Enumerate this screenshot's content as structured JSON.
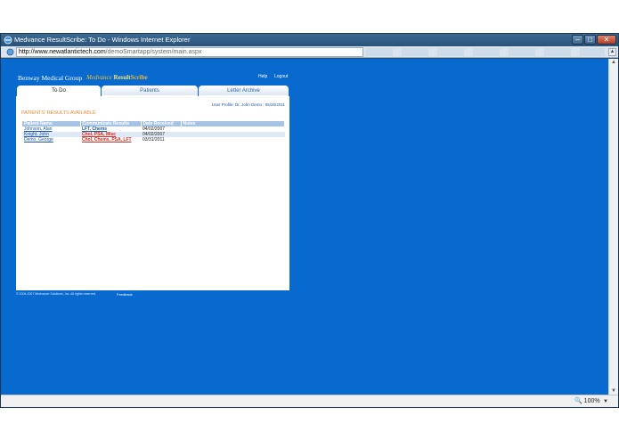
{
  "window": {
    "title": "Medvance ResultScribe: To Do - Windows Internet Explorer",
    "controls": {
      "minimize": "–",
      "maximize": "□",
      "close": "✕"
    }
  },
  "address": {
    "host": "http://www.newatlantictech.com",
    "path": "/demoSmartapp/system/main.aspx"
  },
  "header": {
    "brand": "Benway Medical Group",
    "logo_medvance": "Medvance",
    "logo_result": "Result",
    "logo_scribe": "Scribe",
    "help": "Help",
    "logout": "Logout"
  },
  "tabs": [
    {
      "label": "To Do",
      "active": true
    },
    {
      "label": "Patients",
      "active": false
    },
    {
      "label": "Letter Archive",
      "active": false
    }
  ],
  "user_profile": "User Profile: Dr. John Demo : 05/26/2011",
  "results_heading": "PATIENTS' RESULTS AVAILABLE",
  "table": {
    "headers": [
      "Patient Name",
      "Communicate Results",
      "Date Received",
      "Notes"
    ],
    "rows": [
      {
        "name": "Johnson, Alan",
        "results": "LFT, Chems",
        "results_color": "#1a56b0",
        "date": "04/02/2007",
        "notes": ""
      },
      {
        "name": "Knight, John",
        "results": "Chol, PSA, Misc",
        "results_color": "#d42a1e",
        "date": "04/02/2007",
        "notes": ""
      },
      {
        "name": "Demo, George",
        "results": "Chol, Chems, PSA, LFT",
        "results_color": "#d42a1e",
        "date": "03/31/2011",
        "notes": ""
      }
    ]
  },
  "footer": {
    "copyright": "© 2004-2007 Medvance Solutions, Inc. All rights reserved.",
    "feedback": "Feedback"
  },
  "status": {
    "zoom": "100%"
  },
  "colors": {
    "page_bg": "#0869ce",
    "panel_bg": "#ffffff",
    "accent_orange": "#e78a32",
    "link_blue": "#1a56b0",
    "link_red": "#d42a1e"
  }
}
